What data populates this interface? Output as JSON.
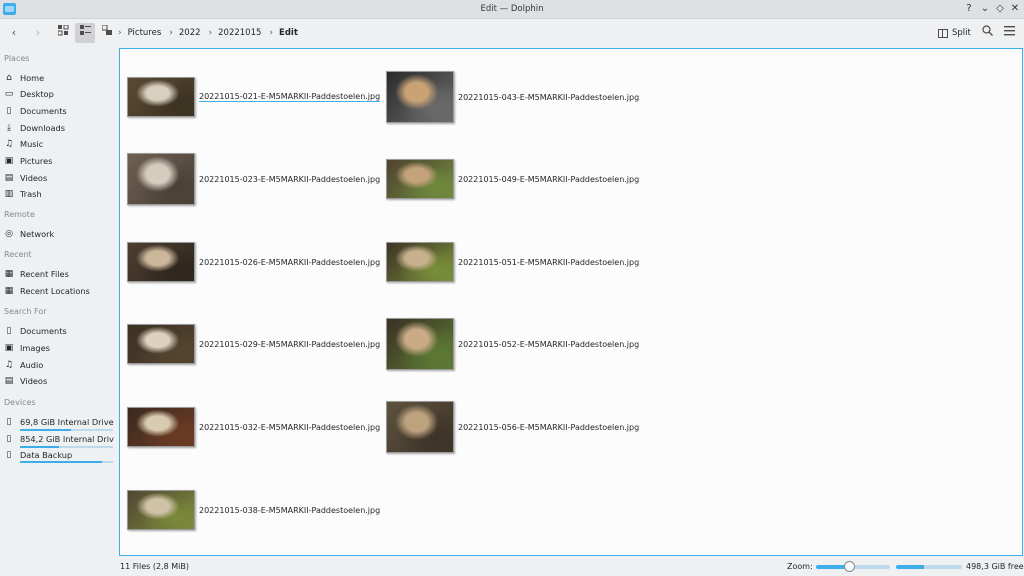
{
  "window": {
    "title": "Edit — Dolphin"
  },
  "colors": {
    "accent": "#3daee9",
    "background": "#eff0f1",
    "view": "#fcfcfc"
  },
  "toolbar": {
    "breadcrumbs": [
      "Pictures",
      "2022",
      "20221015",
      "Edit"
    ],
    "split_label": "Split"
  },
  "sidebar": {
    "places_title": "Places",
    "places": [
      {
        "label": "Home",
        "icon": "home-icon"
      },
      {
        "label": "Desktop",
        "icon": "desktop-icon"
      },
      {
        "label": "Documents",
        "icon": "documents-icon"
      },
      {
        "label": "Downloads",
        "icon": "downloads-icon"
      },
      {
        "label": "Music",
        "icon": "music-icon"
      },
      {
        "label": "Pictures",
        "icon": "pictures-icon"
      },
      {
        "label": "Videos",
        "icon": "videos-icon"
      },
      {
        "label": "Trash",
        "icon": "trash-icon"
      }
    ],
    "remote_title": "Remote",
    "remote": [
      {
        "label": "Network",
        "icon": "network-icon"
      }
    ],
    "recent_title": "Recent",
    "recent": [
      {
        "label": "Recent Files",
        "icon": "recent-files-icon"
      },
      {
        "label": "Recent Locations",
        "icon": "recent-locations-icon"
      }
    ],
    "search_title": "Search For",
    "search": [
      {
        "label": "Documents",
        "icon": "documents-icon"
      },
      {
        "label": "Images",
        "icon": "images-icon"
      },
      {
        "label": "Audio",
        "icon": "audio-icon"
      },
      {
        "label": "Videos",
        "icon": "videos-icon"
      }
    ],
    "devices_title": "Devices",
    "devices": [
      {
        "label": "69,8 GiB Internal Drive",
        "icon": "drive-icon",
        "usage": 0.55
      },
      {
        "label": "854,2 GiB Internal Drive",
        "icon": "drive-icon",
        "usage": 0.42
      },
      {
        "label": "Data Backup",
        "icon": "drive-icon",
        "usage": 0.88
      }
    ]
  },
  "files": [
    {
      "name": "20221015-021-E-M5MARKII-Paddestoelen.jpg",
      "selected": true,
      "colors": [
        "#5a4a34",
        "#d8cfbf",
        "#3d3322"
      ]
    },
    {
      "name": "20221015-043-E-M5MARKII-Paddestoelen.jpg",
      "selected": false,
      "colors": [
        "#2b2b2b",
        "#c9a376",
        "#6b6b6b"
      ]
    },
    {
      "name": "20221015-023-E-M5MARKII-Paddestoelen.jpg",
      "selected": false,
      "colors": [
        "#6d6052",
        "#d6ccbe",
        "#4a4036"
      ]
    },
    {
      "name": "20221015-049-E-M5MARKII-Paddestoelen.jpg",
      "selected": false,
      "colors": [
        "#4f4231",
        "#c4a27c",
        "#6f8a3c"
      ]
    },
    {
      "name": "20221015-026-E-M5MARKII-Paddestoelen.jpg",
      "selected": false,
      "colors": [
        "#4d3f31",
        "#cdb79a",
        "#2e261d"
      ]
    },
    {
      "name": "20221015-051-E-M5MARKII-Paddestoelen.jpg",
      "selected": false,
      "colors": [
        "#3e3327",
        "#c8b08e",
        "#7a8f3a"
      ]
    },
    {
      "name": "20221015-029-E-M5MARKII-Paddestoelen.jpg",
      "selected": false,
      "colors": [
        "#3b3024",
        "#ddd2c0",
        "#54452f"
      ]
    },
    {
      "name": "20221015-052-E-M5MARKII-Paddestoelen.jpg",
      "selected": false,
      "colors": [
        "#3a3125",
        "#c9ab86",
        "#5d7a34"
      ]
    },
    {
      "name": "20221015-032-E-M5MARKII-Paddestoelen.jpg",
      "selected": false,
      "colors": [
        "#3c2a1f",
        "#d9cbb0",
        "#6b3b25"
      ]
    },
    {
      "name": "20221015-056-E-M5MARKII-Paddestoelen.jpg",
      "selected": false,
      "colors": [
        "#5e513f",
        "#bda27e",
        "#3d3428"
      ]
    },
    {
      "name": "20221015-038-E-M5MARKII-Paddestoelen.jpg",
      "selected": false,
      "colors": [
        "#514733",
        "#cfc2a6",
        "#7b8a3a"
      ]
    }
  ],
  "status": {
    "count": "11 Files (2,8 MiB)",
    "zoom_label": "Zoom:",
    "zoom_level": 0.45,
    "space_used": 0.42,
    "free": "498,3 GiB free"
  }
}
